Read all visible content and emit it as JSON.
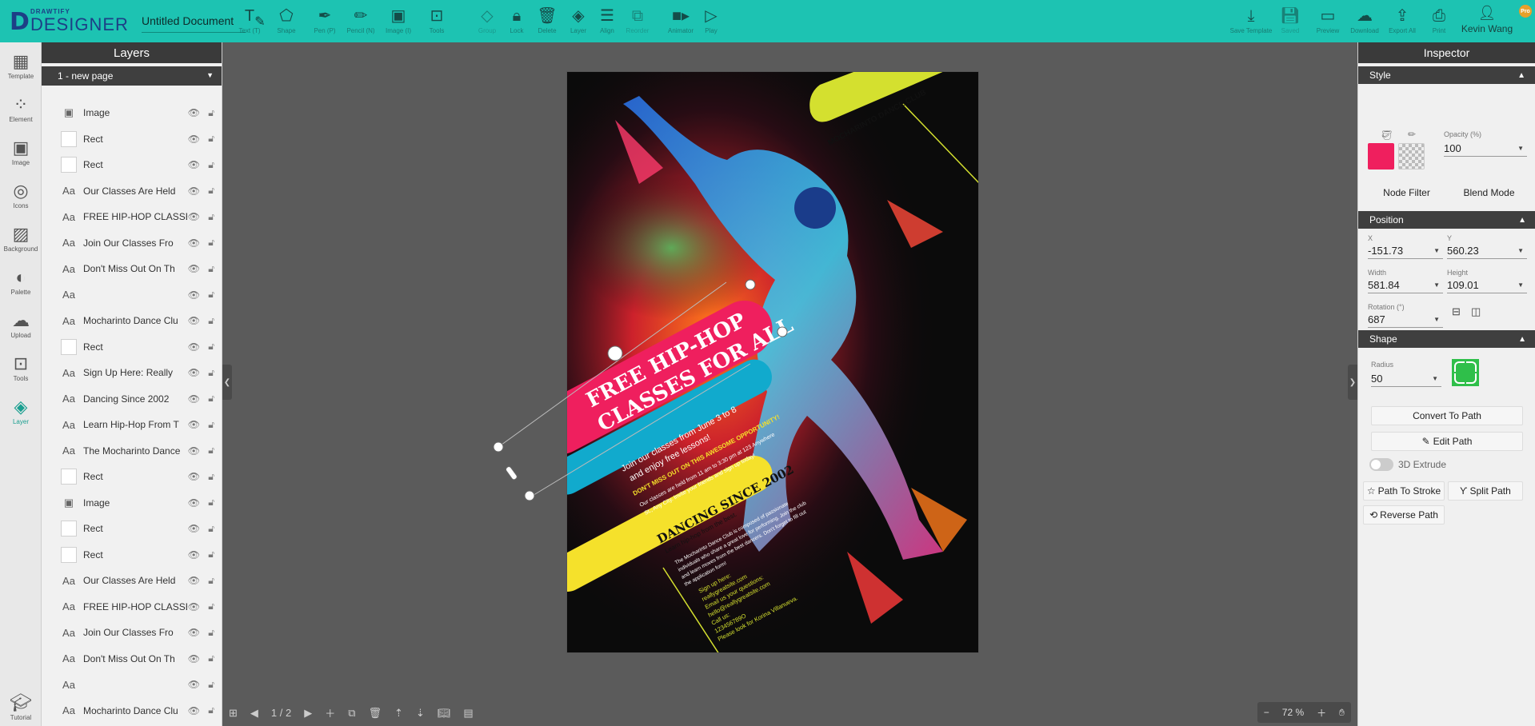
{
  "app": {
    "logo_small": "DRAWTIFY",
    "logo_big": "DESIGNER",
    "doc_name": "Untitled Document"
  },
  "toolbar": {
    "text": "Text (T)",
    "shape": "Shape",
    "pen": "Pen (P)",
    "pencil": "Pencil (N)",
    "image": "Image (I)",
    "tools": "Tools",
    "group": "Group",
    "lock": "Lock",
    "delete": "Delete",
    "layer": "Layer",
    "align": "Align",
    "reorder": "Reorder",
    "animator": "Animator",
    "play": "Play",
    "save_template": "Save Template",
    "saved": "Saved",
    "preview": "Preview",
    "download": "Download",
    "export_all": "Export All",
    "print": "Print",
    "user_name": "Kevin Wang",
    "pro_badge": "Pro"
  },
  "leftrail": {
    "template": "Template",
    "element": "Element",
    "image": "Image",
    "icons": "Icons",
    "background": "Background",
    "palette": "Palette",
    "upload": "Upload",
    "tools": "Tools",
    "layer": "Layer",
    "tutorial": "Tutorial"
  },
  "layers": {
    "title": "Layers",
    "page_select": "1 - new page",
    "items": [
      {
        "type": "image",
        "name": "Image"
      },
      {
        "type": "rect",
        "name": "Rect"
      },
      {
        "type": "rect",
        "name": "Rect"
      },
      {
        "type": "text",
        "name": "Our Classes Are Held"
      },
      {
        "type": "text",
        "name": "FREE HIP-HOP CLASSES"
      },
      {
        "type": "text",
        "name": "Join Our Classes Fro"
      },
      {
        "type": "text",
        "name": "Don't Miss Out On Th"
      },
      {
        "type": "text",
        "name": ""
      },
      {
        "type": "text",
        "name": "Mocharinto Dance Clu"
      },
      {
        "type": "rect",
        "name": "Rect"
      },
      {
        "type": "text",
        "name": "Sign Up Here: Really"
      },
      {
        "type": "text",
        "name": "Dancing Since 2002"
      },
      {
        "type": "text",
        "name": "Learn Hip-Hop From T"
      },
      {
        "type": "text",
        "name": "The Mocharinto Dance"
      },
      {
        "type": "rect",
        "name": "Rect"
      },
      {
        "type": "image",
        "name": "Image"
      },
      {
        "type": "rect",
        "name": "Rect"
      },
      {
        "type": "rect",
        "name": "Rect"
      },
      {
        "type": "text",
        "name": "Our Classes Are Held"
      },
      {
        "type": "text",
        "name": "FREE HIP-HOP CLASSES"
      },
      {
        "type": "text",
        "name": "Join Our Classes Fro"
      },
      {
        "type": "text",
        "name": "Don't Miss Out On Th"
      },
      {
        "type": "text",
        "name": ""
      },
      {
        "type": "text",
        "name": "Mocharinto Dance Clu"
      }
    ]
  },
  "poster": {
    "club": "MOCHARINTO DANCE CLUB",
    "headline1": "FREE HIP-HOP",
    "headline2": "CLASSES FOR ALL",
    "join1": "Join our classes from June 3 to 8",
    "join2": "and enjoy free lessons!",
    "dontmiss": "DON'T MISS OUT ON THIS AWESOME OPPORTUNITY!",
    "held1": "Our classes are held from 11 am to 3:30 pm at 123 Anywhere",
    "held2": "St., Any City. Invite your friends and sign up today!",
    "since": "DANCING SINCE 2002",
    "learn": "Learn hip-hop from the best.",
    "about1": "The Mocharinto Dance Club is composed of passionate",
    "about2": "individuals who share a great love for performing. Join the club",
    "about3": "and learn moves from the best dancers. Don't forget to fill out",
    "about4": "the application form!",
    "sign1": "Sign up here:",
    "sign2": "reallygreatsite.com",
    "sign3": "Email us your questions:",
    "sign4": "hello@reallygreatsite.com",
    "sign5": "Call us:",
    "sign6": "123456789O",
    "sign7": "Please look for Korina Villanueva."
  },
  "bottom": {
    "page_indicator": "1 / 2",
    "zoom": "72 %"
  },
  "inspector": {
    "title": "Inspector",
    "style_label": "Style",
    "fill_color": "#ef1f5e",
    "opacity_label": "Opacity (%)",
    "opacity": "100",
    "node_filter": "Node Filter",
    "blend_mode": "Blend Mode",
    "position_label": "Position",
    "x_label": "X",
    "x": "-151.73",
    "y_label": "Y",
    "y": "560.23",
    "width_label": "Width",
    "width": "581.84",
    "height_label": "Height",
    "height": "109.01",
    "rotation_label": "Rotation (°)",
    "rotation": "687",
    "shape_label": "Shape",
    "radius_label": "Radius",
    "radius": "50",
    "convert_to_path": "Convert To Path",
    "edit_path": "Edit Path",
    "extrude": "3D Extrude",
    "path_to_stroke": "Path To Stroke",
    "split_path": "Split Path",
    "reverse_path": "Reverse Path"
  },
  "colors": {
    "accent": "#1dc3b2",
    "pink": "#ef1f5e",
    "cyan": "#11aacd",
    "yellow": "#f5e12b",
    "lime": "#d4e02f"
  }
}
